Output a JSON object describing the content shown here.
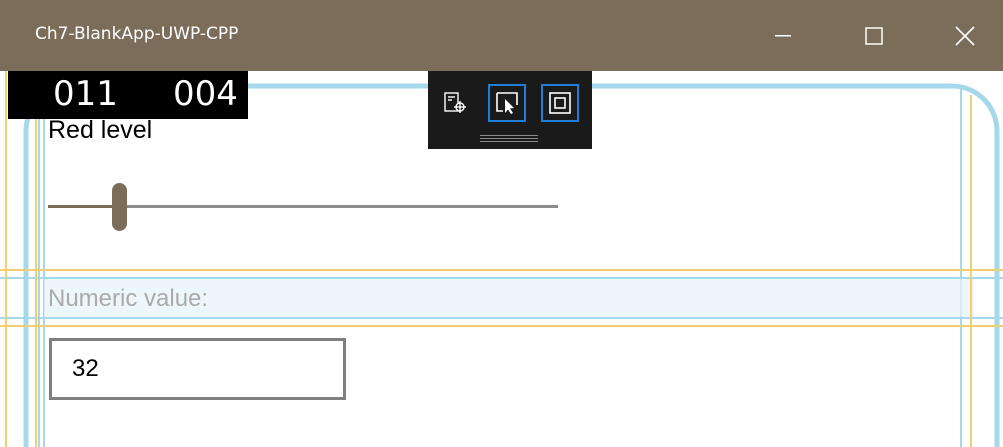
{
  "window": {
    "title": "Ch7-BlankApp-UWP-CPP",
    "accent": "#7b6d5a"
  },
  "frame_counter": {
    "left": "011",
    "right": "004"
  },
  "debug_toolbar": {
    "buttons": [
      {
        "icon": "live-visual-tree-icon",
        "active": false
      },
      {
        "icon": "select-element-icon",
        "active": true
      },
      {
        "icon": "display-layout-adorners-icon",
        "active": true
      }
    ]
  },
  "red_level": {
    "label": "Red level",
    "value_fraction": 0.14
  },
  "numeric": {
    "label": "Numeric value:",
    "value": "32"
  }
}
